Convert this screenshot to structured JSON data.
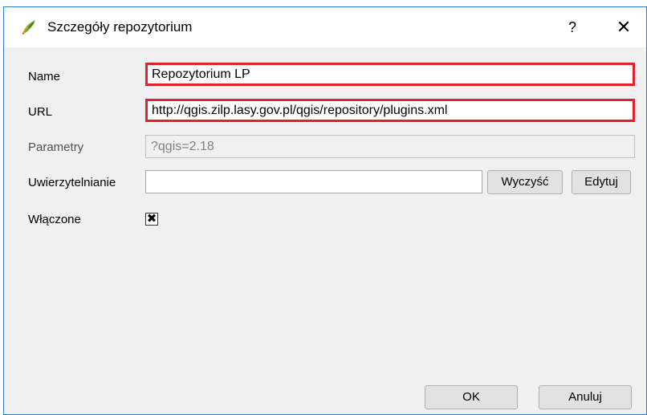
{
  "dialog": {
    "title": "Szczegóły repozytorium",
    "help_label": "?",
    "close_label": "✕"
  },
  "form": {
    "name": {
      "label": "Name",
      "value": "Repozytorium LP"
    },
    "url": {
      "label": "URL",
      "value": "http://qgis.zilp.lasy.gov.pl/qgis/repository/plugins.xml"
    },
    "params": {
      "label": "Parametry",
      "value": "?qgis=2.18"
    },
    "auth": {
      "label": "Uwierzytelnianie",
      "value": "",
      "clear_label": "Wyczyść",
      "edit_label": "Edytuj"
    },
    "enabled": {
      "label": "Włączone",
      "checked": true,
      "mark": "✖"
    }
  },
  "buttons": {
    "ok_label": "OK",
    "cancel_label": "Anuluj"
  },
  "colors": {
    "highlight": "#e0202a",
    "dialog_border": "#2f7fd0",
    "background": "#f0f0f0"
  }
}
